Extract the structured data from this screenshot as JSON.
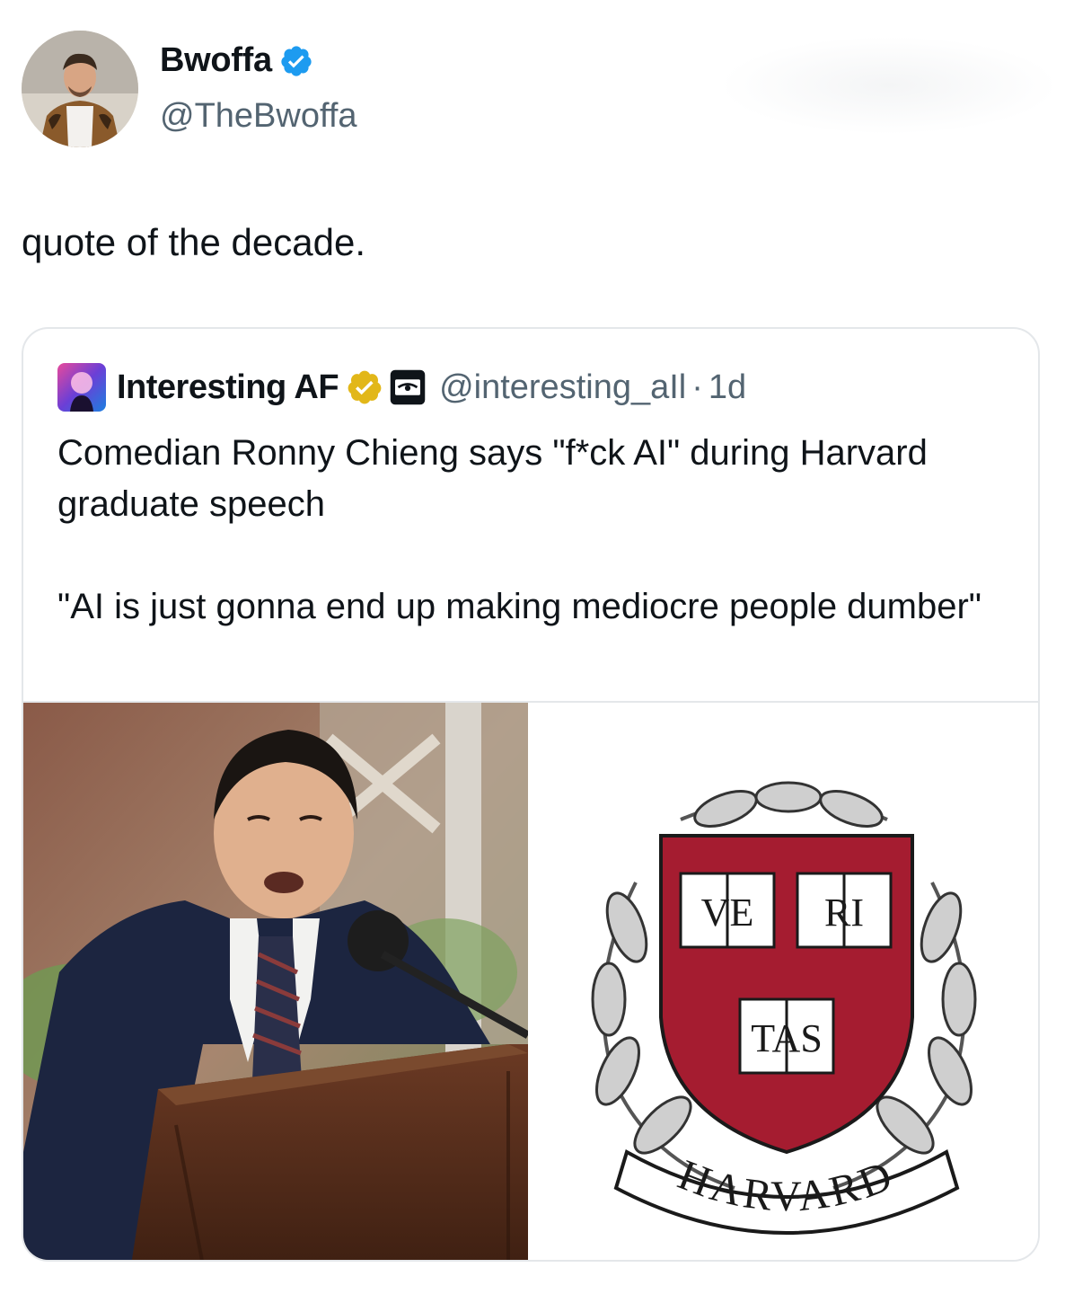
{
  "tweet": {
    "author": {
      "display_name": "Bwoffa",
      "handle": "@TheBwoffa",
      "avatar_icon": "profile-photo",
      "verified_icon": "verified-badge-icon",
      "verified_color": "#1d9bf0"
    },
    "text": "quote of the decade."
  },
  "quoted_tweet": {
    "author": {
      "display_name": "Interesting AF",
      "handle": "@interesting_aIl",
      "verified_icon": "gold-verified-badge-icon",
      "verified_color": "#e2b719",
      "affiliate_icon": "affiliate-badge-icon"
    },
    "separator": "·",
    "time": "1d",
    "text_line1": "Comedian Ronny Chieng says \"f*ck AI\" during Harvard graduate speech",
    "text_line2": "\"AI is just gonna end up making mediocre people dumber\"",
    "media": [
      {
        "kind": "photo",
        "icon": "speaker-at-podium-photo"
      },
      {
        "kind": "logo",
        "icon": "harvard-shield-logo",
        "shield_color": "#a51c30",
        "book_texts": [
          "VE",
          "RI",
          "TAS"
        ],
        "banner_text": "HARVARD"
      }
    ]
  }
}
